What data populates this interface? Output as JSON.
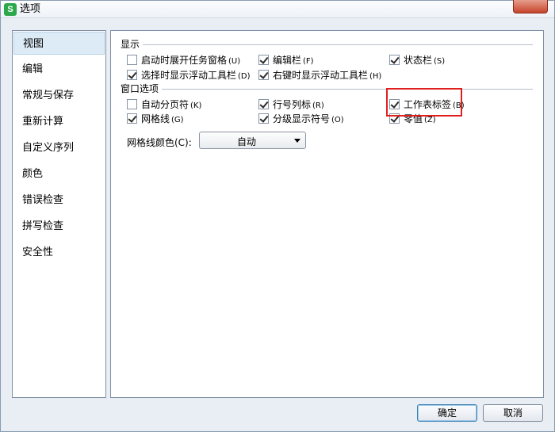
{
  "window": {
    "title": "选项",
    "app_icon_letter": "S"
  },
  "sidebar": {
    "items": [
      {
        "label": "视图",
        "selected": true
      },
      {
        "label": "编辑"
      },
      {
        "label": "常规与保存"
      },
      {
        "label": "重新计算"
      },
      {
        "label": "自定义序列"
      },
      {
        "label": "颜色"
      },
      {
        "label": "错误检查"
      },
      {
        "label": "拼写检查"
      },
      {
        "label": "安全性"
      }
    ]
  },
  "display_group": {
    "title": "显示",
    "options": [
      {
        "label": "启动时展开任务窗格",
        "shortcut": "(U)",
        "checked": false
      },
      {
        "label": "编辑栏",
        "shortcut": "(F)",
        "checked": true
      },
      {
        "label": "状态栏",
        "shortcut": "(S)",
        "checked": true
      },
      {
        "label": "选择时显示浮动工具栏",
        "shortcut": "(D)",
        "checked": true
      },
      {
        "label": "右键时显示浮动工具栏",
        "shortcut": "(H)",
        "checked": true
      }
    ]
  },
  "window_group": {
    "title": "窗口选项",
    "options": [
      {
        "label": "自动分页符",
        "shortcut": "(K)",
        "checked": false
      },
      {
        "label": "行号列标",
        "shortcut": "(R)",
        "checked": true
      },
      {
        "label": "工作表标签",
        "shortcut": "(B)",
        "checked": true
      },
      {
        "label": "网格线",
        "shortcut": "(G)",
        "checked": true
      },
      {
        "label": "分级显示符号",
        "shortcut": "(O)",
        "checked": true
      },
      {
        "label": "零值",
        "shortcut": "(Z)",
        "checked": true
      }
    ],
    "gridline_color": {
      "label": "网格线颜色(C):",
      "value": "自动"
    }
  },
  "buttons": {
    "ok": "确定",
    "cancel": "取消"
  },
  "colors": {
    "highlight": "#e02020",
    "selected_bg": "#dcebf6",
    "app_green": "#2aa84a"
  }
}
